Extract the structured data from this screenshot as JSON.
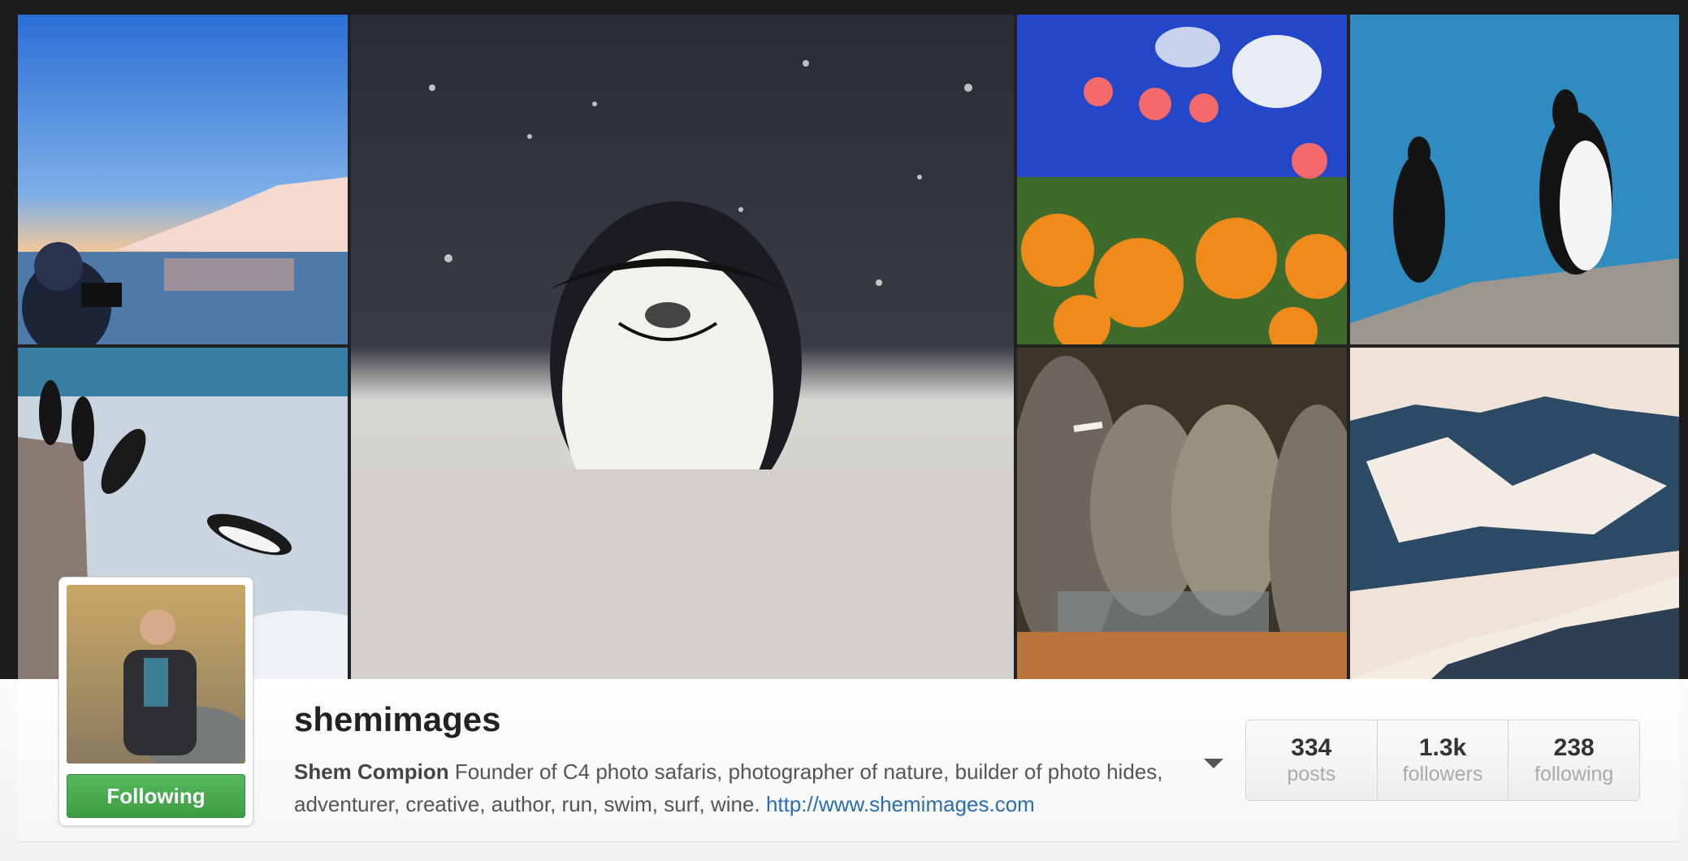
{
  "profile": {
    "username": "shemimages",
    "display_name": "Shem Compion",
    "bio": "Founder of C4 photo safaris, photographer of nature, builder of photo hides, adventurer, creative, author, run, swim, surf, wine.",
    "website": "http://www.shemimages.com",
    "follow_button_label": "Following"
  },
  "stats": [
    {
      "value": "334",
      "label": "posts"
    },
    {
      "value": "1.3k",
      "label": "followers"
    },
    {
      "value": "238",
      "label": "following"
    }
  ],
  "colors": {
    "follow_green": "#4cae52",
    "link_blue": "#2b6dad"
  }
}
